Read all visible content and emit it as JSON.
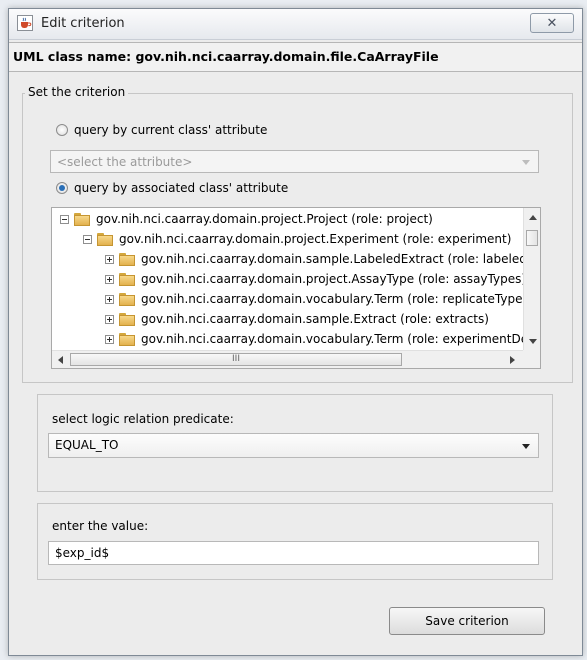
{
  "window": {
    "title": "Edit criterion",
    "icon": "java-cup-icon",
    "close_label": "✕"
  },
  "uml_class": {
    "text": "UML class name: gov.nih.nci.caarray.domain.file.CaArrayFile"
  },
  "criterion_group": {
    "label": "Set the criterion",
    "radio_current": {
      "label": "query by current class' attribute",
      "checked": false
    },
    "attribute_select": {
      "placeholder": "<select the attribute>",
      "enabled": false
    },
    "radio_associated": {
      "label": "query by associated class' attribute",
      "checked": true
    }
  },
  "tree": {
    "rows": [
      {
        "label": "gov.nih.nci.caarray.domain.project.Project (role: project)",
        "expanded": true,
        "level": 0
      },
      {
        "label": "gov.nih.nci.caarray.domain.project.Experiment (role: experiment)",
        "expanded": true,
        "level": 1
      },
      {
        "label": "gov.nih.nci.caarray.domain.sample.LabeledExtract (role: labeledExtracts)",
        "expanded": false,
        "level": 2
      },
      {
        "label": "gov.nih.nci.caarray.domain.project.AssayType (role: assayTypes)",
        "expanded": false,
        "level": 2
      },
      {
        "label": "gov.nih.nci.caarray.domain.vocabulary.Term (role: replicateType)",
        "expanded": false,
        "level": 2
      },
      {
        "label": "gov.nih.nci.caarray.domain.sample.Extract (role: extracts)",
        "expanded": false,
        "level": 2
      },
      {
        "label": "gov.nih.nci.caarray.domain.vocabulary.Term (role: experimentDesignTypes)",
        "expanded": false,
        "level": 2
      }
    ],
    "hscroll_grip": "III"
  },
  "predicate_group": {
    "label": "select logic relation predicate:",
    "selected": "EQUAL_TO"
  },
  "value_group": {
    "label": "enter the value:",
    "value": "$exp_id$"
  },
  "actions": {
    "save_label": "Save criterion"
  },
  "colors": {
    "accent": "#2a6fb7",
    "folder": "#e2b14e"
  }
}
